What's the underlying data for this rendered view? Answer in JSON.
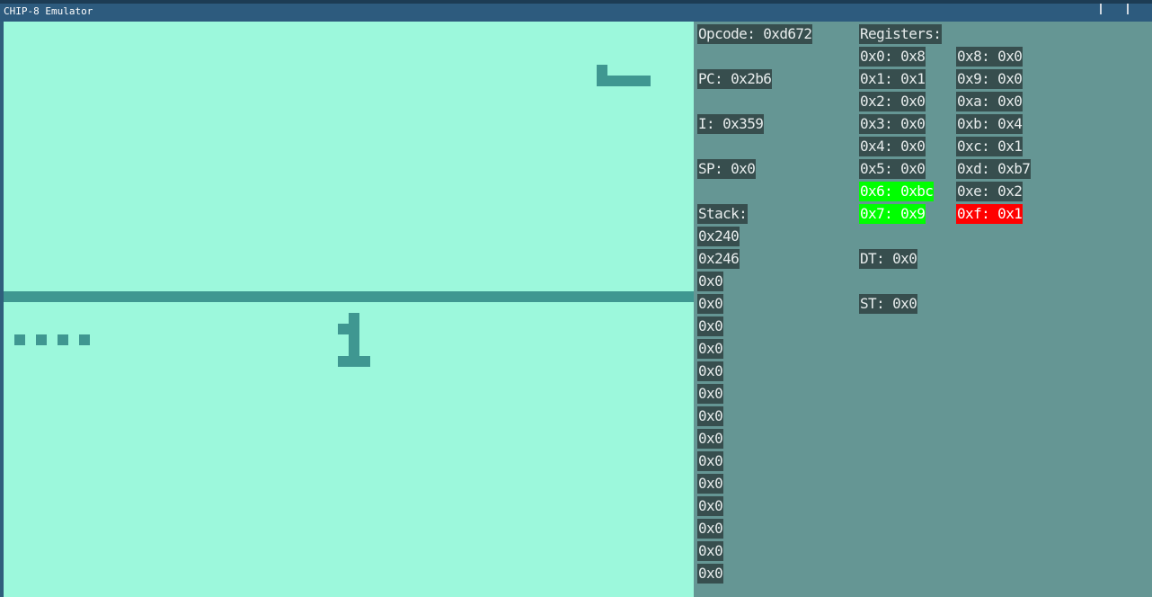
{
  "window": {
    "title": "CHIP-8 Emulator"
  },
  "colors": {
    "screen_background": "#9cf8dc",
    "screen_pixel": "#3f9791",
    "panel_background": "#659694",
    "label_background": "#374e4e",
    "label_text": "#e7ecec",
    "highlight_green": "#00ff00",
    "highlight_red": "#ff0000",
    "titlebar": "#2d5b7e"
  },
  "debug": {
    "opcode": "Opcode: 0xd672",
    "pc": "PC: 0x2b6",
    "i": "I: 0x359",
    "sp": "SP: 0x0",
    "stack_header": "Stack:",
    "stack": [
      "0x240",
      "0x246",
      "0x0",
      "0x0",
      "0x0",
      "0x0",
      "0x0",
      "0x0",
      "0x0",
      "0x0",
      "0x0",
      "0x0",
      "0x0",
      "0x0",
      "0x0",
      "0x0"
    ],
    "registers_header": "Registers:",
    "registers_left": [
      "0x0: 0x8",
      "0x1: 0x1",
      "0x2: 0x0",
      "0x3: 0x0",
      "0x4: 0x0",
      "0x5: 0x0",
      "0x6: 0xbc",
      "0x7: 0x9"
    ],
    "registers_right": [
      "0x8: 0x0",
      "0x9: 0x0",
      "0xa: 0x0",
      "0xb: 0x4",
      "0xc: 0x1",
      "0xd: 0xb7",
      "0xe: 0x2",
      "0xf: 0x1"
    ],
    "highlighted_registers": {
      "green": [
        "0x6",
        "0x7"
      ],
      "red": [
        "0xf"
      ]
    },
    "dt": "DT: 0x0",
    "st": "ST: 0x0"
  }
}
